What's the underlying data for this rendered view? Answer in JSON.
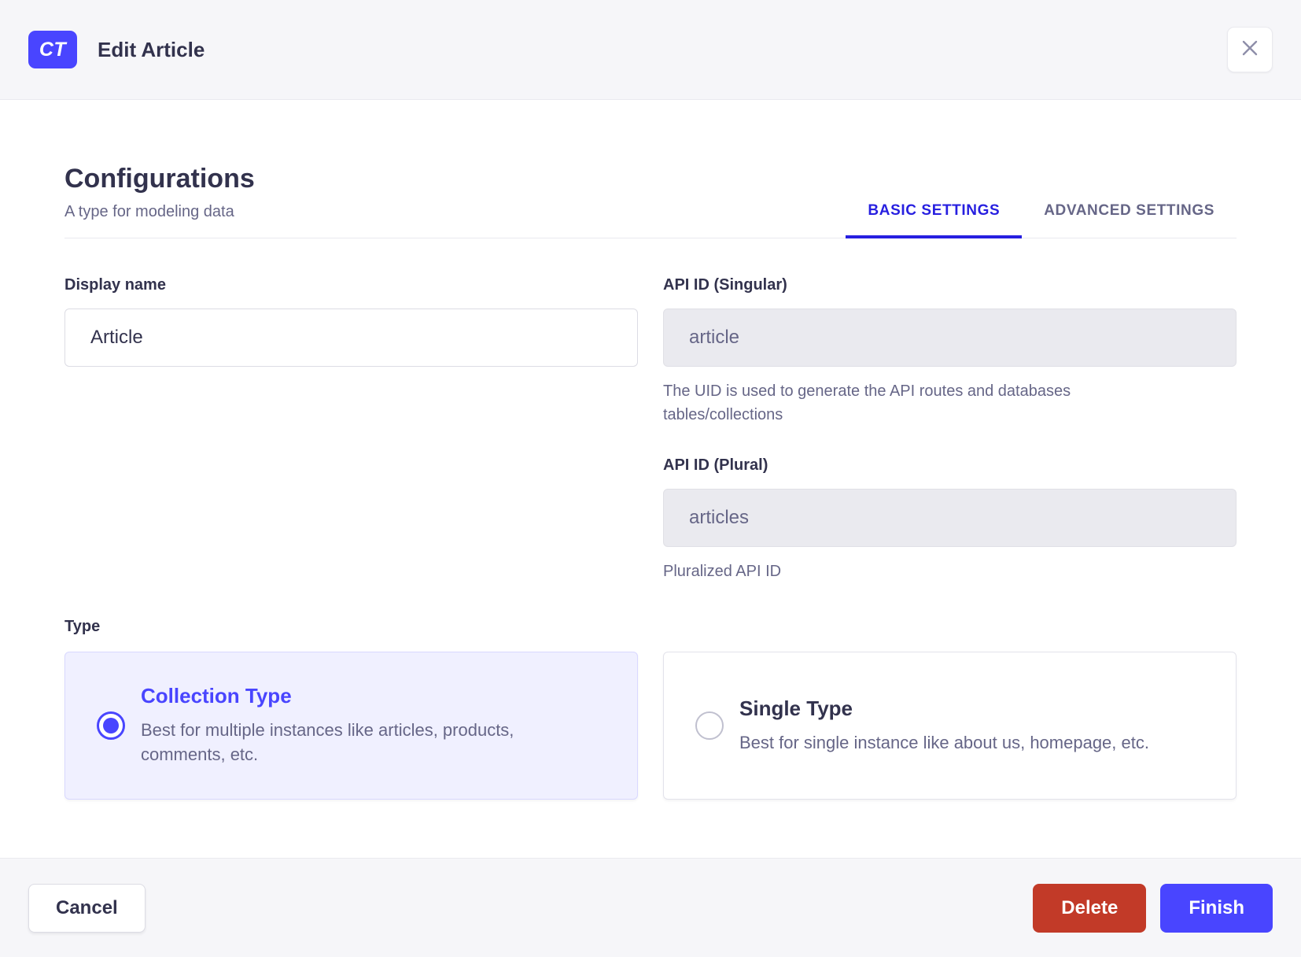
{
  "header": {
    "badge_label": "CT",
    "title": "Edit Article"
  },
  "config": {
    "title": "Configurations",
    "subtitle": "A type for modeling data",
    "tabs": [
      {
        "label": "BASIC SETTINGS",
        "active": true
      },
      {
        "label": "ADVANCED SETTINGS",
        "active": false
      }
    ]
  },
  "form": {
    "display_name": {
      "label": "Display name",
      "value": "Article"
    },
    "api_id_singular": {
      "label": "API ID (Singular)",
      "value": "article",
      "helper": "The UID is used to generate the API routes and databases tables/collections"
    },
    "api_id_plural": {
      "label": "API ID (Plural)",
      "value": "articles",
      "helper": "Pluralized API ID"
    },
    "type": {
      "label": "Type",
      "options": [
        {
          "title": "Collection Type",
          "description": "Best for multiple instances like articles, products, comments, etc.",
          "selected": true
        },
        {
          "title": "Single Type",
          "description": "Best for single instance like about us, homepage, etc.",
          "selected": false
        }
      ]
    }
  },
  "footer": {
    "cancel_label": "Cancel",
    "delete_label": "Delete",
    "finish_label": "Finish"
  },
  "icons": {
    "close": "close-icon"
  },
  "colors": {
    "primary": "#4945FF",
    "tab_active": "#271FE0",
    "danger": "#C23A28",
    "text_dark": "#32324D",
    "text_muted": "#666687",
    "border": "#DCDCE4",
    "disabled_bg": "#EAEAEF",
    "selected_card_bg": "#F0F0FF",
    "header_bg": "#F6F6F9"
  }
}
